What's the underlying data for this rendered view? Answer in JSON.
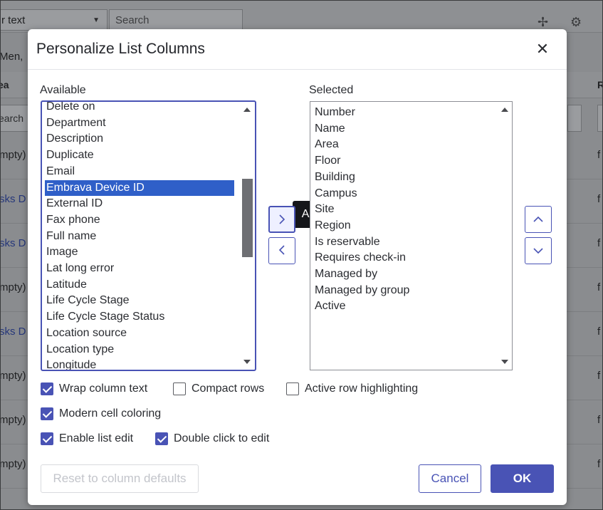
{
  "background": {
    "filter_select": "r text",
    "search_placeholder": "Search",
    "breadcrumb": "Men,",
    "col_header_left": "ea",
    "col_header_right": "R",
    "search_cell": "earch",
    "rows": [
      {
        "left": "mpty)",
        "right": "f"
      },
      {
        "left": "sks D",
        "right": "f",
        "link": true
      },
      {
        "left": "sks D",
        "right": "f",
        "link": true
      },
      {
        "left": "mpty)",
        "right": "f"
      },
      {
        "left": "sks D",
        "right": "f",
        "link": true
      },
      {
        "left": "mpty)",
        "right": "f"
      },
      {
        "left": "mpty)",
        "right": "f"
      },
      {
        "left": "mpty)",
        "right": "f"
      }
    ]
  },
  "modal": {
    "title": "Personalize List Columns",
    "available_label": "Available",
    "selected_label": "Selected",
    "available": [
      "Delete on",
      "Department",
      "Description",
      "Duplicate",
      "Email",
      "Embrava Device ID",
      "External ID",
      "Fax phone",
      "Full name",
      "Image",
      "Lat long error",
      "Latitude",
      "Life Cycle Stage",
      "Life Cycle Stage Status",
      "Location source",
      "Location type",
      "Longitude"
    ],
    "available_selected_index": 5,
    "selected": [
      "Number",
      "Name",
      "Area",
      "Floor",
      "Building",
      "Campus",
      "Site",
      "Region",
      "Is reservable",
      "Requires check-in",
      "Managed by",
      "Managed by group",
      "Active"
    ],
    "tooltip": "Add",
    "options": {
      "wrap_column_text": {
        "label": "Wrap column text",
        "checked": true
      },
      "compact_rows": {
        "label": "Compact rows",
        "checked": false
      },
      "active_row_highlighting": {
        "label": "Active row highlighting",
        "checked": false
      },
      "modern_cell_coloring": {
        "label": "Modern cell coloring",
        "checked": true
      },
      "enable_list_edit": {
        "label": "Enable list edit",
        "checked": true
      },
      "double_click_to_edit": {
        "label": "Double click to edit",
        "checked": true
      }
    },
    "reset_label": "Reset to column defaults",
    "cancel_label": "Cancel",
    "ok_label": "OK"
  },
  "colors": {
    "accent": "#4953b5",
    "selection": "#2f5fc8",
    "tooltip": "#15161a"
  }
}
